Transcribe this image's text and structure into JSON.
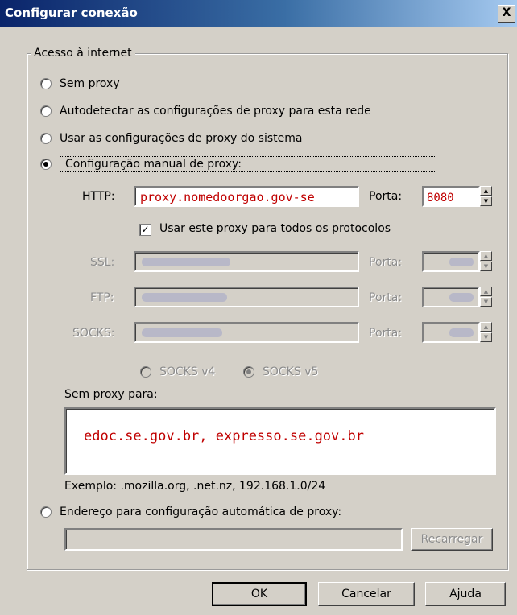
{
  "window": {
    "title": "Configurar conexão",
    "close": "X"
  },
  "group": {
    "legend": "Acesso à internet"
  },
  "options": {
    "no_proxy": "Sem proxy",
    "auto_detect": "Autodetectar as configurações de proxy para esta rede",
    "system": "Usar as configurações de proxy do sistema",
    "manual": "Configuração manual de proxy:"
  },
  "manual": {
    "http_label": "HTTP:",
    "http_value": "proxy.nomedoorgao.gov-se",
    "port_label": "Porta:",
    "http_port": "8080",
    "use_all_label": "Usar este proxy para todos os protocolos",
    "ssl_label": "SSL:",
    "ftp_label": "FTP:",
    "socks_label": "SOCKS:",
    "socks_v4": "SOCKS v4",
    "socks_v5": "SOCKS v5"
  },
  "no_proxy_for": {
    "label": "Sem proxy para:",
    "value": "edoc.se.gov.br,  expresso.se.gov.br",
    "example": "Exemplo: .mozilla.org, .net.nz, 192.168.1.0/24"
  },
  "auto_config": {
    "label": "Endereço para configuração automática de proxy:",
    "reload": "Recarregar"
  },
  "buttons": {
    "ok": "OK",
    "cancel": "Cancelar",
    "help": "Ajuda"
  }
}
